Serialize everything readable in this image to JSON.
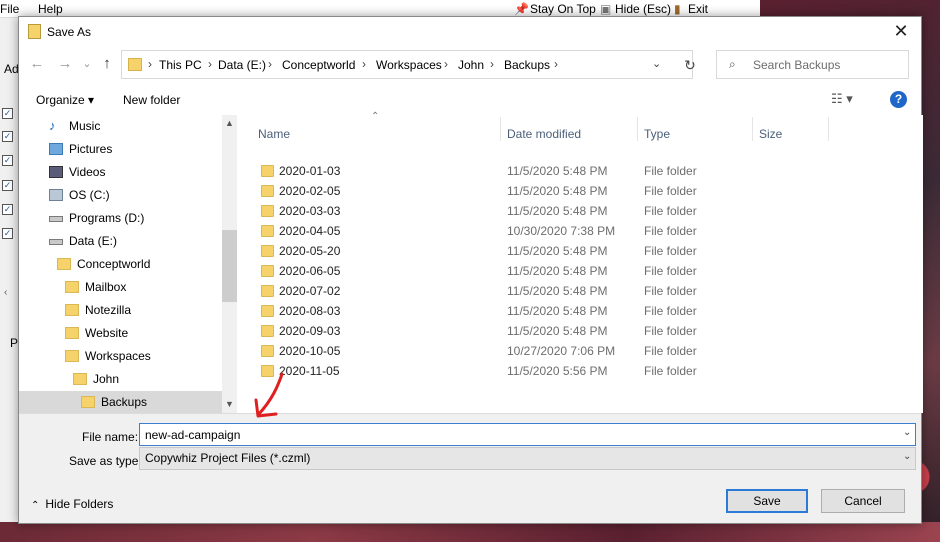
{
  "background_app": {
    "menu_file": "File",
    "menu_help": "Help",
    "stay_on_top": "Stay On Top",
    "hide": "Hide (Esc)",
    "exit": "Exit",
    "left_label": "Ad",
    "p_label": "P"
  },
  "dialog": {
    "title": "Save As",
    "close_glyph": "✕"
  },
  "address": {
    "crumbs": [
      "This PC",
      "Data (E:)",
      "Conceptworld",
      "Workspaces",
      "John",
      "Backups"
    ],
    "separator": "›",
    "search_placeholder": "Search Backups"
  },
  "toolbar": {
    "organize": "Organize ▾",
    "new_folder": "New folder",
    "help": "?"
  },
  "nav": {
    "items": [
      {
        "label": "Music",
        "icon": "music-icon"
      },
      {
        "label": "Pictures",
        "icon": "pictures-icon"
      },
      {
        "label": "Videos",
        "icon": "videos-icon"
      },
      {
        "label": "OS (C:)",
        "icon": "drive-icon"
      },
      {
        "label": "Programs (D:)",
        "icon": "drive-icon"
      },
      {
        "label": "Data (E:)",
        "icon": "drive-icon"
      },
      {
        "label": "Conceptworld",
        "icon": "folder-icon"
      },
      {
        "label": "Mailbox",
        "icon": "folder-icon"
      },
      {
        "label": "Notezilla",
        "icon": "folder-icon"
      },
      {
        "label": "Website",
        "icon": "folder-icon"
      },
      {
        "label": "Workspaces",
        "icon": "folder-icon"
      },
      {
        "label": "John",
        "icon": "folder-icon"
      },
      {
        "label": "Backups",
        "icon": "folder-icon"
      }
    ]
  },
  "list": {
    "columns": {
      "name": "Name",
      "date": "Date modified",
      "type": "Type",
      "size": "Size"
    },
    "rows": [
      {
        "name": "2020-01-03",
        "date": "11/5/2020 5:48 PM",
        "type": "File folder"
      },
      {
        "name": "2020-02-05",
        "date": "11/5/2020 5:48 PM",
        "type": "File folder"
      },
      {
        "name": "2020-03-03",
        "date": "11/5/2020 5:48 PM",
        "type": "File folder"
      },
      {
        "name": "2020-04-05",
        "date": "10/30/2020 7:38 PM",
        "type": "File folder"
      },
      {
        "name": "2020-05-20",
        "date": "11/5/2020 5:48 PM",
        "type": "File folder"
      },
      {
        "name": "2020-06-05",
        "date": "11/5/2020 5:48 PM",
        "type": "File folder"
      },
      {
        "name": "2020-07-02",
        "date": "11/5/2020 5:48 PM",
        "type": "File folder"
      },
      {
        "name": "2020-08-03",
        "date": "11/5/2020 5:48 PM",
        "type": "File folder"
      },
      {
        "name": "2020-09-03",
        "date": "11/5/2020 5:48 PM",
        "type": "File folder"
      },
      {
        "name": "2020-10-05",
        "date": "10/27/2020 7:06 PM",
        "type": "File folder"
      },
      {
        "name": "2020-11-05",
        "date": "11/5/2020 5:56 PM",
        "type": "File folder"
      }
    ]
  },
  "form": {
    "file_name_label": "File name:",
    "file_name_value": "new-ad-campaign",
    "save_type_label": "Save as type:",
    "save_type_value": "Copywhiz Project Files (*.czml)",
    "hide_folders": "Hide Folders",
    "save": "Save",
    "cancel": "Cancel"
  },
  "colors": {
    "accent": "#1e66c8",
    "folder": "#f5d36a",
    "annotation": "#e02020"
  }
}
